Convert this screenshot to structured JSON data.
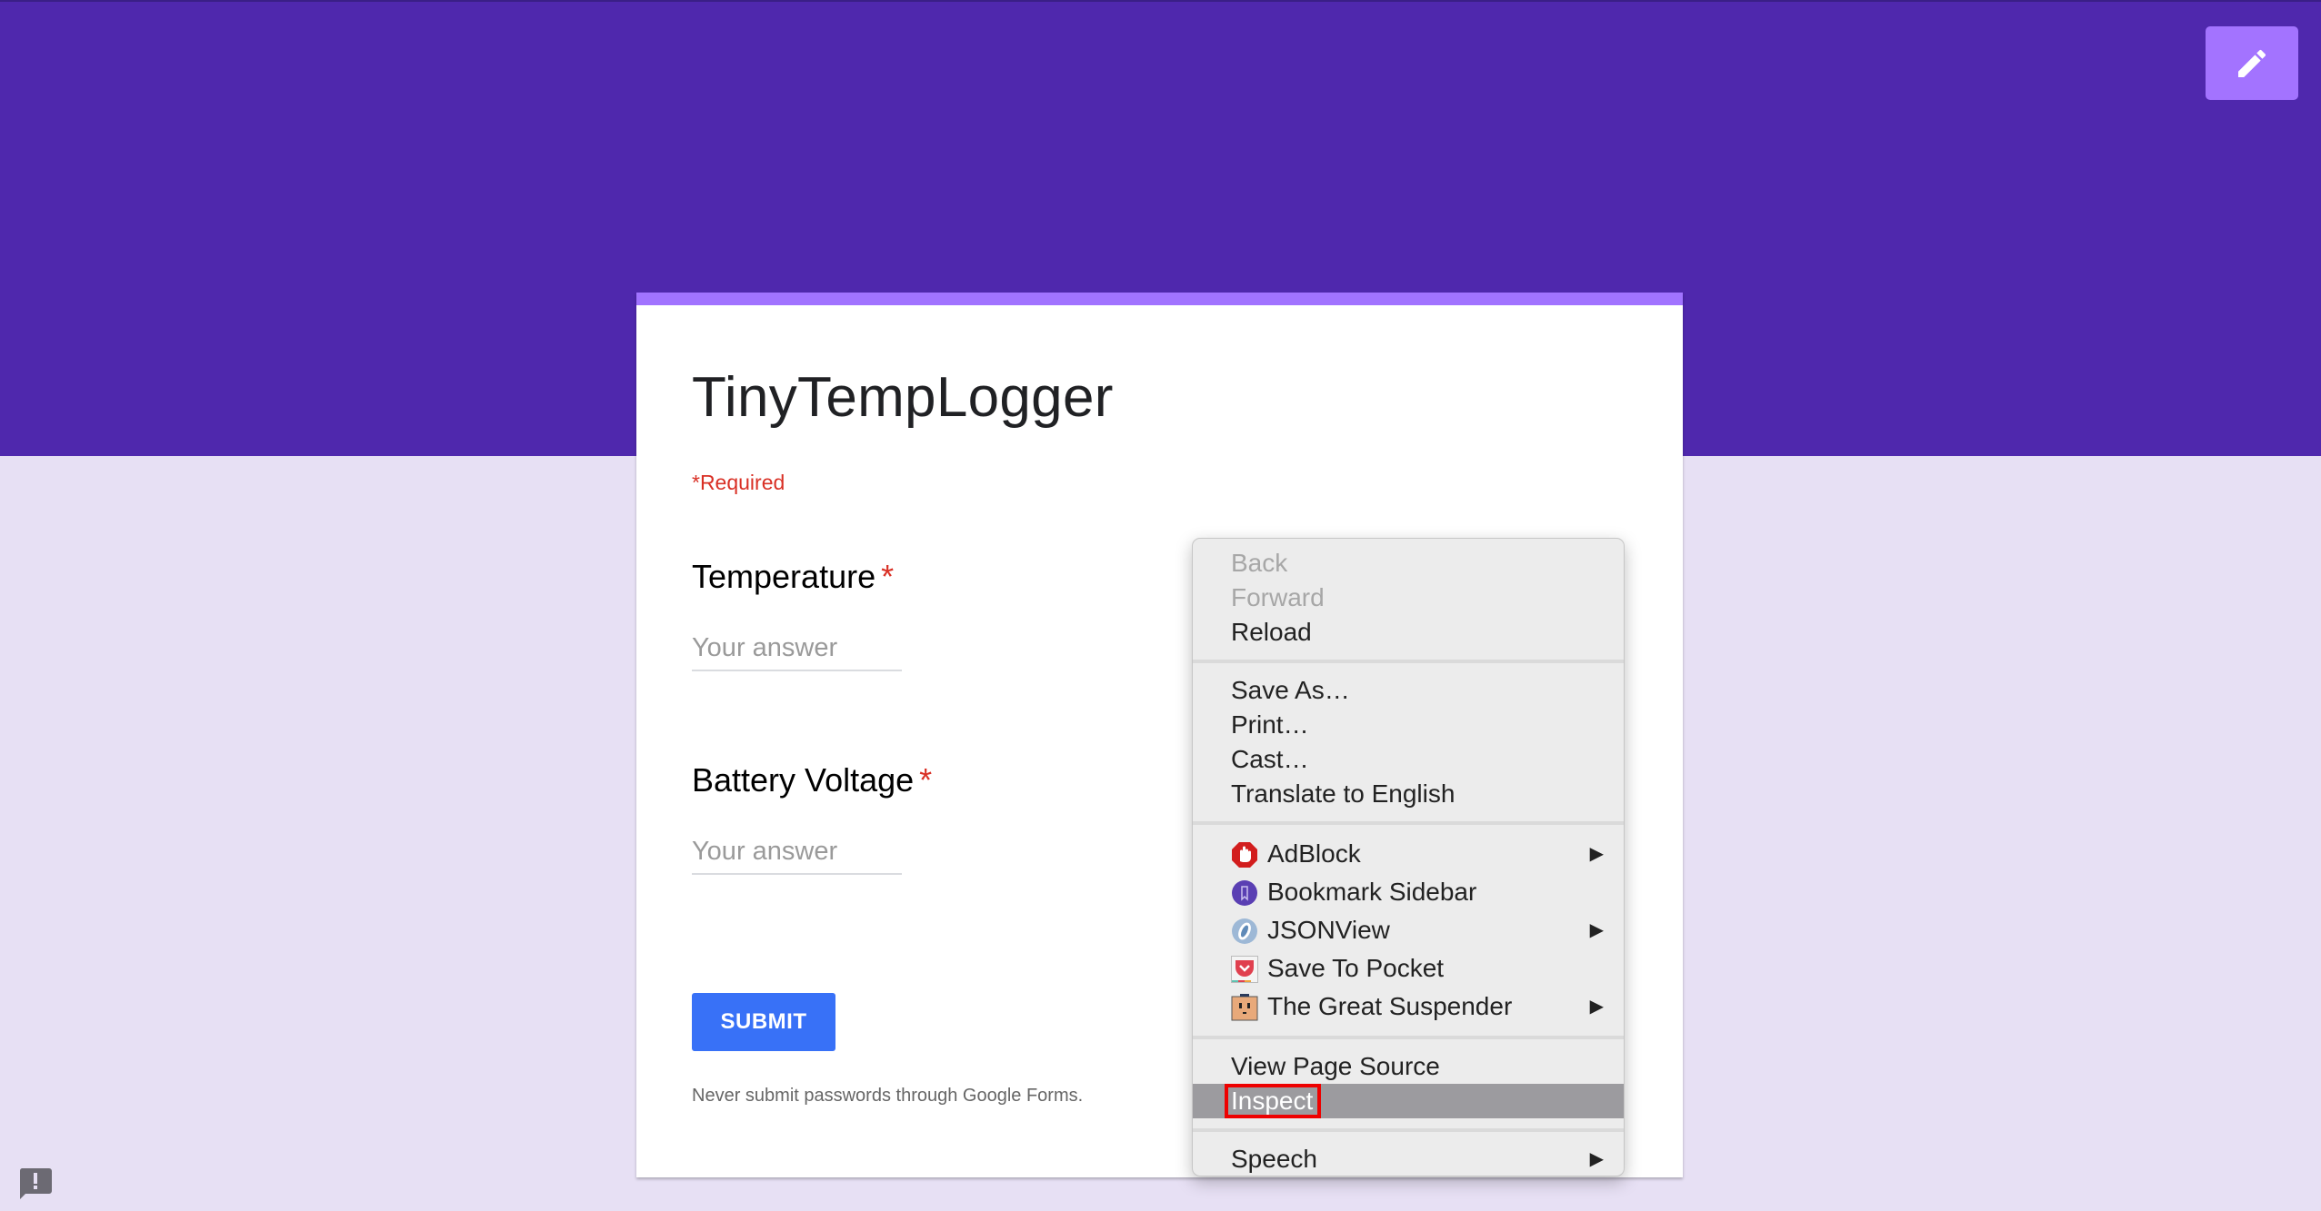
{
  "header": {
    "edit_button_icon": "pencil-icon",
    "colors": {
      "band": "#4f28ad",
      "accent": "#a173ff",
      "background": "#e7e0f4"
    }
  },
  "form": {
    "title": "TinyTempLogger",
    "required_note": "*Required",
    "questions": [
      {
        "label": "Temperature",
        "required_mark": "*",
        "placeholder": "Your answer",
        "value": ""
      },
      {
        "label": "Battery Voltage",
        "required_mark": "*",
        "placeholder": "Your answer",
        "value": ""
      }
    ],
    "submit_label": "SUBMIT",
    "footer_note": "Never submit passwords through Google Forms."
  },
  "feedback_icon": "report-problem-icon",
  "context_menu": {
    "groups": [
      [
        {
          "label": "Back",
          "disabled": true
        },
        {
          "label": "Forward",
          "disabled": true
        },
        {
          "label": "Reload",
          "disabled": false
        }
      ],
      [
        {
          "label": "Save As…"
        },
        {
          "label": "Print…"
        },
        {
          "label": "Cast…"
        },
        {
          "label": "Translate to English"
        }
      ],
      [
        {
          "label": "AdBlock",
          "icon": "adblock-icon",
          "submenu": true
        },
        {
          "label": "Bookmark Sidebar",
          "icon": "bookmark-sidebar-icon",
          "submenu": false
        },
        {
          "label": "JSONView",
          "icon": "jsonview-icon",
          "submenu": true
        },
        {
          "label": "Save To Pocket",
          "icon": "pocket-icon",
          "submenu": false
        },
        {
          "label": "The Great Suspender",
          "icon": "great-suspender-icon",
          "submenu": true
        }
      ],
      [
        {
          "label": "View Page Source"
        },
        {
          "label": "Inspect",
          "highlighted": true
        }
      ],
      [
        {
          "label": "Speech",
          "submenu": true
        }
      ]
    ],
    "submenu_arrow": "▶"
  }
}
